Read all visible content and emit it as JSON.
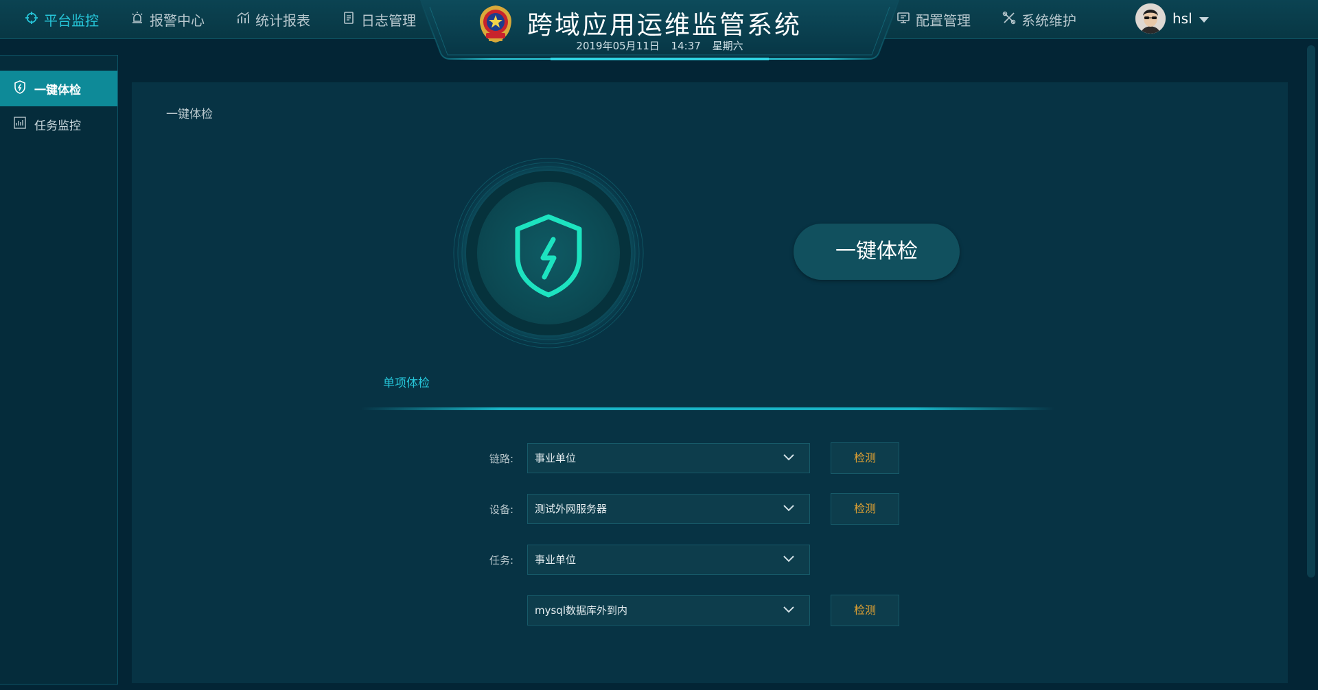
{
  "app": {
    "title": "跨域应用运维监管系统",
    "date": "2019年05月11日",
    "time": "14:37",
    "weekday": "星期六"
  },
  "nav_left": [
    {
      "label": "平台监控",
      "icon": "crosshair-icon",
      "active": true
    },
    {
      "label": "报警中心",
      "icon": "alarm-light-icon"
    },
    {
      "label": "统计报表",
      "icon": "bar-chart-icon"
    },
    {
      "label": "日志管理",
      "icon": "document-icon"
    }
  ],
  "nav_right": [
    {
      "label": "配置管理",
      "icon": "monitor-icon"
    },
    {
      "label": "系统维护",
      "icon": "tools-icon"
    }
  ],
  "user": {
    "name": "hsl"
  },
  "sidebar": {
    "items": [
      {
        "label": "一键体检",
        "icon": "shield-bolt-icon",
        "active": true
      },
      {
        "label": "任务监控",
        "icon": "report-icon"
      }
    ]
  },
  "main": {
    "breadcrumb": "一键体检",
    "onekey_button": "一键体检",
    "tab_label": "单项体检",
    "rows": [
      {
        "label": "链路:",
        "value": "事业单位",
        "button": "检测"
      },
      {
        "label": "设备:",
        "value": "测试外网服务器",
        "button": "检测"
      },
      {
        "label": "任务:",
        "value": "事业单位",
        "button": ""
      },
      {
        "label": "",
        "value": "mysql数据库外到内",
        "button": "检测"
      }
    ]
  },
  "colors": {
    "accent": "#26c6d9",
    "check_text": "#e2a232",
    "shield_glow": "#1de3c0",
    "background": "#032535"
  }
}
